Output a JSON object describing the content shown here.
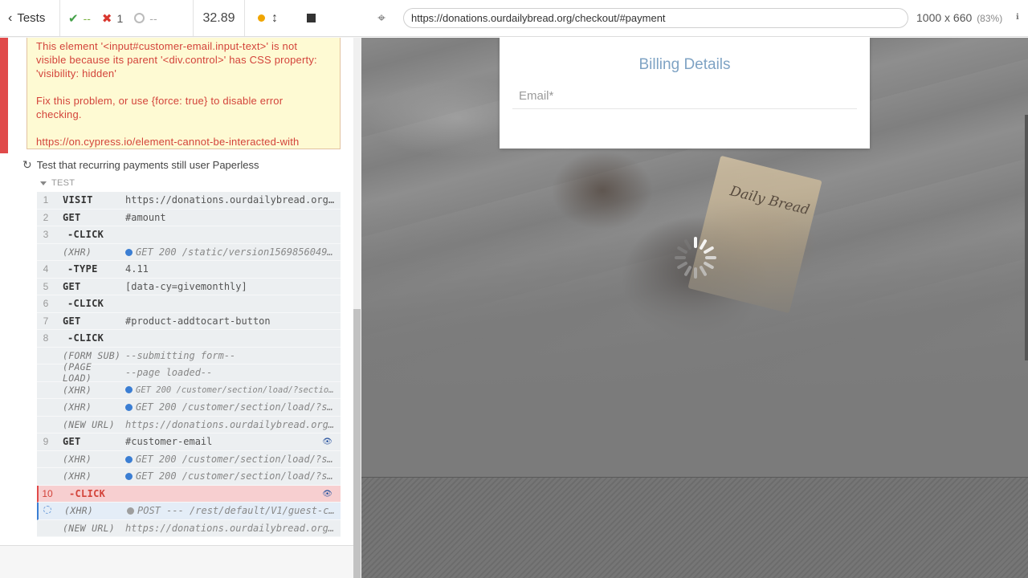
{
  "reporter": {
    "header": {
      "tests_label": "Tests",
      "passed": "--",
      "failed": "1",
      "pending": "--",
      "duration": "32.89"
    },
    "error": {
      "line1": "This element '<input#customer-email.input-text>' is not visible because its parent '<div.control>' has CSS property: 'visibility: hidden'",
      "line2": "Fix this problem, or use {force: true} to disable error checking.",
      "link": "https://on.cypress.io/element-cannot-be-interacted-with"
    },
    "test_title": "Test that recurring payments still user Paperless",
    "section_label": "TEST",
    "commands": [
      {
        "num": "1",
        "name": "VISIT",
        "msg": "https://donations.ourdailybread.org/ge...",
        "kind": "cmd"
      },
      {
        "num": "2",
        "name": "GET",
        "msg": "#amount",
        "kind": "cmd"
      },
      {
        "num": "3",
        "name": "-CLICK",
        "msg": "",
        "kind": "child"
      },
      {
        "num": "",
        "name": "(XHR)",
        "msg": "GET 200 /static/version1569856049...",
        "kind": "xhr"
      },
      {
        "num": "4",
        "name": "-TYPE",
        "msg": "4.11",
        "kind": "child"
      },
      {
        "num": "5",
        "name": "GET",
        "msg": "[data-cy=givemonthly]",
        "kind": "cmd"
      },
      {
        "num": "6",
        "name": "-CLICK",
        "msg": "",
        "kind": "child"
      },
      {
        "num": "7",
        "name": "GET",
        "msg": "#product-addtocart-button",
        "kind": "cmd"
      },
      {
        "num": "8",
        "name": "-CLICK",
        "msg": "",
        "kind": "child"
      },
      {
        "num": "",
        "name": "(FORM SUB)",
        "msg": "--submitting form--",
        "kind": "event"
      },
      {
        "num": "",
        "name": "(PAGE LOAD)",
        "msg": "--page loaded--",
        "kind": "event"
      },
      {
        "num": "",
        "name": "(XHR)",
        "msg": "GET 200 /customer/section/load/?sections...",
        "kind": "xhr-small"
      },
      {
        "num": "",
        "name": "(XHR)",
        "msg": "GET 200 /customer/section/load/?s...",
        "kind": "xhr"
      },
      {
        "num": "",
        "name": "(NEW URL)",
        "msg": "https://donations.ourdailybread.org...",
        "kind": "event"
      },
      {
        "num": "9",
        "name": "GET",
        "msg": "#customer-email",
        "kind": "cmd-eye"
      },
      {
        "num": "",
        "name": "(XHR)",
        "msg": "GET 200 /customer/section/load/?s...",
        "kind": "xhr"
      },
      {
        "num": "",
        "name": "(XHR)",
        "msg": "GET 200 /customer/section/load/?s...",
        "kind": "xhr"
      },
      {
        "num": "10",
        "name": "-CLICK",
        "msg": "",
        "kind": "failed"
      },
      {
        "num": "",
        "name": "(XHR)",
        "msg": "POST --- /rest/default/V1/guest-c...",
        "kind": "pending"
      },
      {
        "num": "",
        "name": "(NEW URL)",
        "msg": "https://donations.ourdailybread.org...",
        "kind": "event"
      }
    ]
  },
  "aut": {
    "url": "https://donations.ourdailybread.org/checkout/#payment",
    "viewport": "1000 x 660",
    "scale": "(83%)",
    "billing_title": "Billing Details",
    "email_placeholder": "Email*",
    "book_text": "Daily Bread"
  },
  "icons": {
    "back": "chevron-left-icon",
    "pass": "check-icon",
    "fail": "x-icon",
    "pending": "circle-icon",
    "selector": "crosshair-icon"
  },
  "colors": {
    "fail_red": "#e04a4a",
    "error_bg": "#fefad3",
    "accent_blue": "#3b7ed3",
    "billing_title": "#7fa3c4"
  }
}
